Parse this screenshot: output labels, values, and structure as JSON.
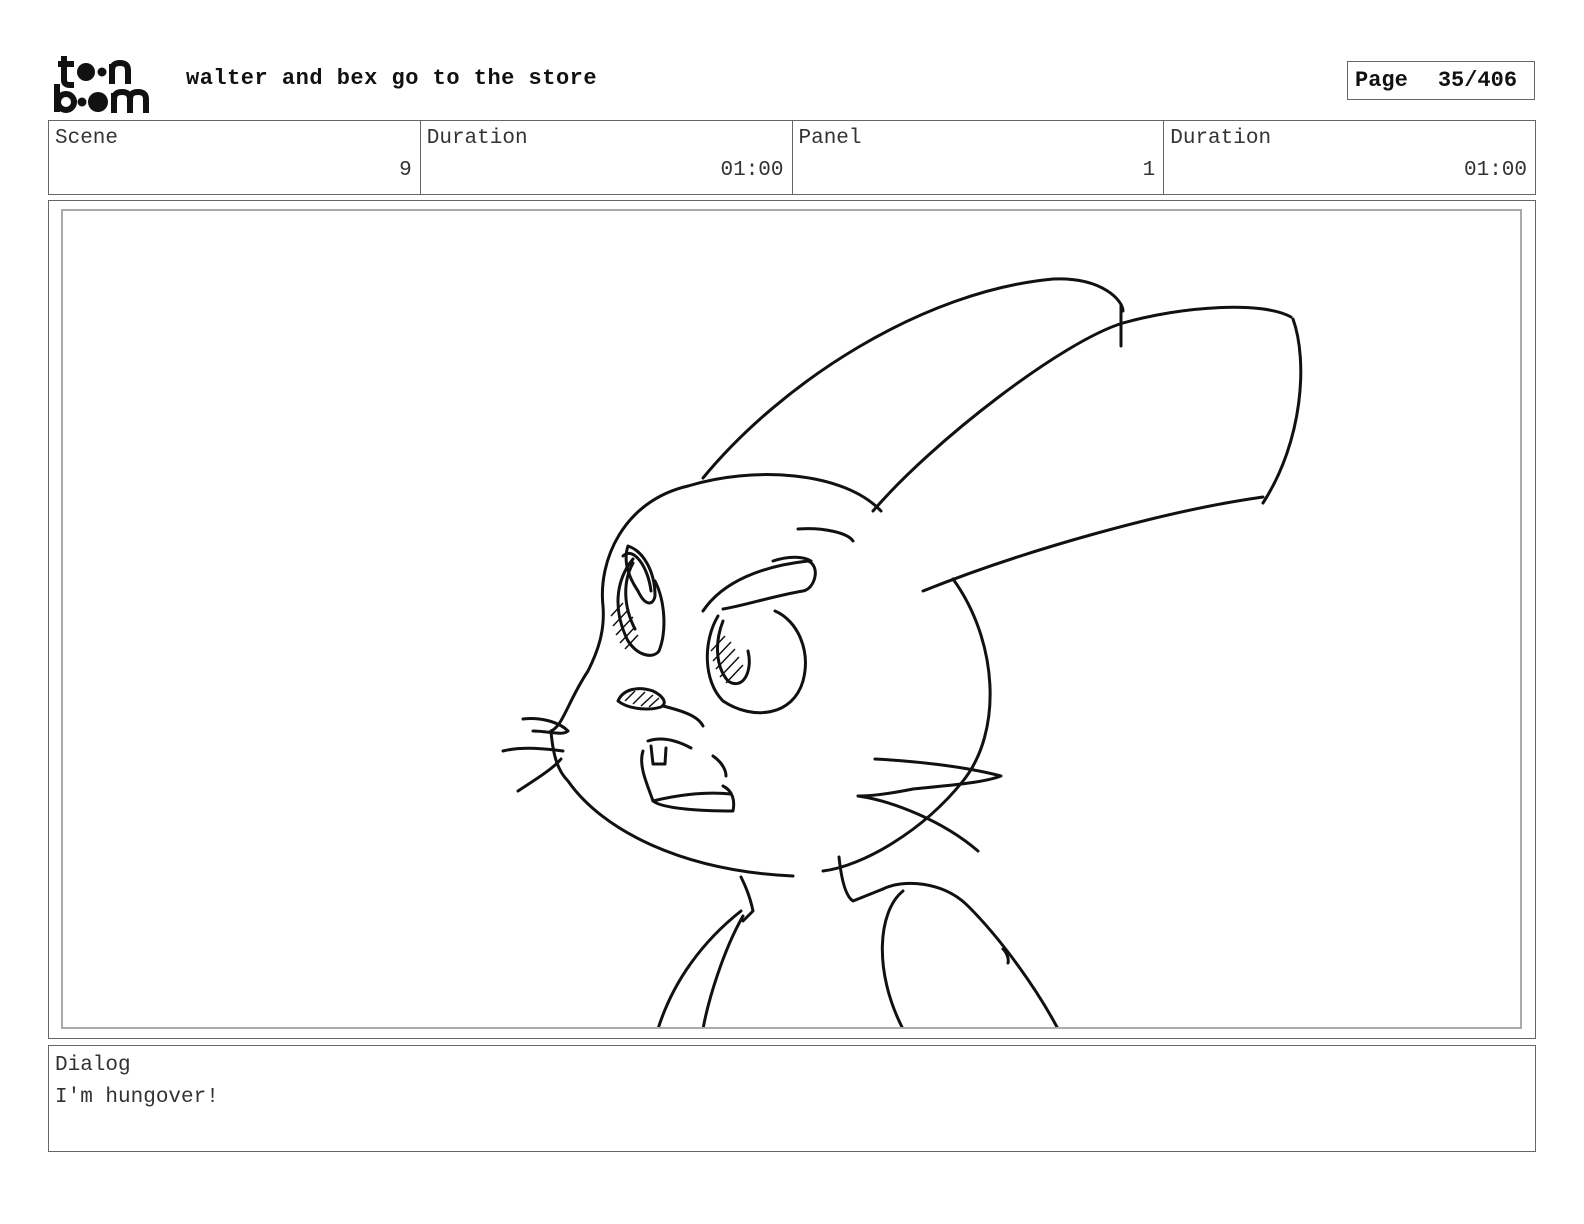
{
  "header": {
    "logo_text_top": "toon",
    "logo_text_bottom": "boom",
    "project_title": "walter and bex go to the store",
    "page_label": "Page",
    "page_number": "35/406"
  },
  "info": {
    "scene_label": "Scene",
    "scene_value": "9",
    "scene_duration_label": "Duration",
    "scene_duration_value": "01:00",
    "panel_label": "Panel",
    "panel_value": "1",
    "panel_duration_label": "Duration",
    "panel_duration_value": "01:00"
  },
  "panel": {
    "image_icon": "rabbit-sketch"
  },
  "dialog": {
    "label": "Dialog",
    "text": "I'm hungover!"
  }
}
